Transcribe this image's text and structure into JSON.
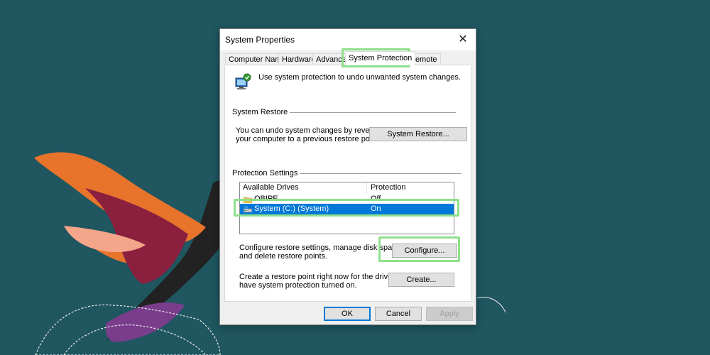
{
  "window": {
    "title": "System Properties"
  },
  "tabs": [
    {
      "label": "Computer Name"
    },
    {
      "label": "Hardware"
    },
    {
      "label": "Advanced"
    },
    {
      "label": "System Protection"
    },
    {
      "label": "Remote"
    }
  ],
  "intro": {
    "text": "Use system protection to undo unwanted system changes."
  },
  "system_restore": {
    "group_title": "System Restore",
    "desc_line1": "You can undo system changes by reverting",
    "desc_line2": "your computer to a previous restore point.",
    "button_label": "System Restore..."
  },
  "protection_settings": {
    "group_title": "Protection Settings",
    "columns": [
      "Available Drives",
      "Protection"
    ],
    "drives": [
      {
        "name": "OBIPE",
        "protection": "Off",
        "icon": "folder-icon"
      },
      {
        "name": "System (C:) (System)",
        "protection": "On",
        "icon": "system-drive-icon",
        "selected": true
      }
    ],
    "configure_line1": "Configure restore settings, manage disk space,",
    "configure_line2": "and delete restore points.",
    "configure_label": "Configure...",
    "create_line1": "Create a restore point right now for the drives that",
    "create_line2": "have system protection turned on.",
    "create_label": "Create..."
  },
  "footer": {
    "ok": "OK",
    "cancel": "Cancel",
    "apply": "Apply"
  },
  "colors": {
    "highlight": "#8fe08a",
    "selection": "#0078d7",
    "background": "#1f5660"
  }
}
